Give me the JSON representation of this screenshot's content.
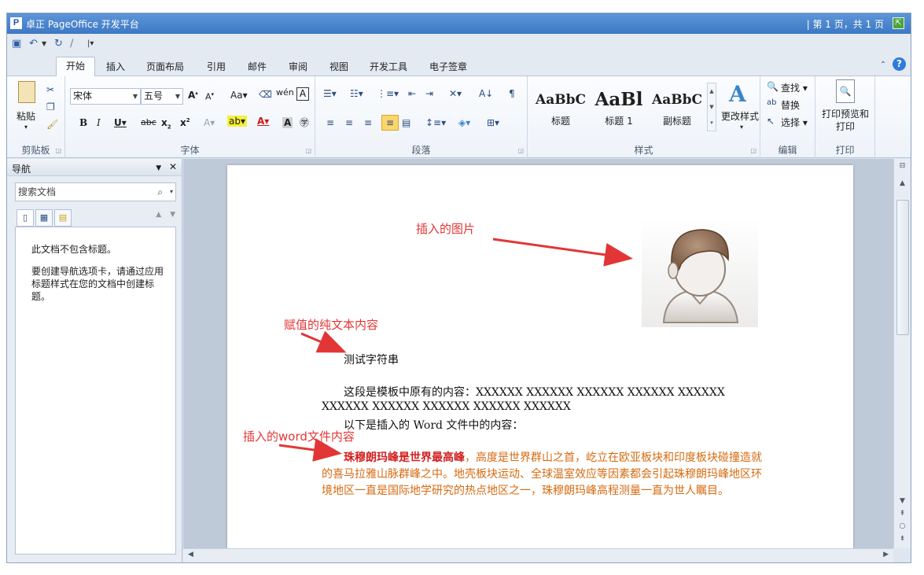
{
  "window": {
    "logo": "P",
    "title": "卓正 PageOffice 开发平台",
    "page_info": "| 第 1 页，共 1 页"
  },
  "tabs": [
    {
      "label": "开始",
      "active": true
    },
    {
      "label": "插入",
      "active": false
    },
    {
      "label": "页面布局",
      "active": false
    },
    {
      "label": "引用",
      "active": false
    },
    {
      "label": "邮件",
      "active": false
    },
    {
      "label": "审阅",
      "active": false
    },
    {
      "label": "视图",
      "active": false
    },
    {
      "label": "开发工具",
      "active": false
    },
    {
      "label": "电子签章",
      "active": false
    }
  ],
  "ribbon": {
    "clipboard": {
      "label": "剪贴板",
      "paste": "粘贴"
    },
    "font": {
      "label": "字体",
      "name": "宋体",
      "size": "五号"
    },
    "paragraph": {
      "label": "段落"
    },
    "styles": {
      "label": "样式",
      "items": [
        {
          "sample": "AaBbC",
          "name": "标题"
        },
        {
          "sample": "AaBl",
          "name": "标题 1"
        },
        {
          "sample": "AaBbC",
          "name": "副标题"
        }
      ],
      "change": "更改样式"
    },
    "editing": {
      "label": "编辑",
      "find": "查找",
      "replace": "替换",
      "select": "选择"
    },
    "print": {
      "label": "打印",
      "preview_line1": "打印预览和",
      "preview_line2": "打印"
    }
  },
  "nav": {
    "title": "导航",
    "search_placeholder": "搜索文档",
    "msg1": "此文档不包含标题。",
    "msg2": "要创建导航选项卡，请通过应用标题样式在您的文档中创建标题。"
  },
  "document": {
    "anno_image": "插入的图片",
    "anno_text": "赋值的纯文本内容",
    "anno_word": "插入的word文件内容",
    "test_string": "测试字符串",
    "para1_line1": "这段是模板中原有的内容：XXXXXX  XXXXXX  XXXXXX  XXXXXX  XXXXXX",
    "para1_line2": "XXXXXX XXXXXX XXXXXX XXXXXX XXXXXX",
    "para2": "以下是插入的 Word 文件中的内容：",
    "word_bold": "珠穆朗玛峰是世界最高峰",
    "word_line1": "，高度是世界群山之首，屹立在欧亚板块和印度板块碰撞造就",
    "word_line2": "的喜马拉雅山脉群峰之中。地壳板块运动、全球温室效应等因素都会引起珠穆朗玛峰地区环",
    "word_line3": "境地区一直是国际地学研究的热点地区之一，珠穆朗玛峰高程测量一直为世人瞩目。"
  },
  "colors": {
    "annotation": "#e23636",
    "orange_text": "#d66a10",
    "title_bar": "#3d78c4"
  }
}
